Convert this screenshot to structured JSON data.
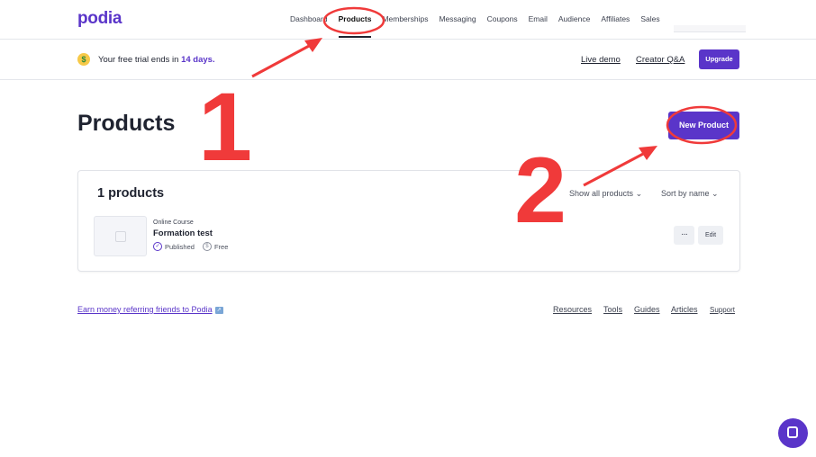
{
  "brand": {
    "logo": "podia",
    "accent": "#5a35c9"
  },
  "nav": {
    "items": [
      {
        "label": "Dashboard",
        "active": false
      },
      {
        "label": "Products",
        "active": true
      },
      {
        "label": "Memberships",
        "active": false
      },
      {
        "label": "Messaging",
        "active": false
      },
      {
        "label": "Coupons",
        "active": false
      },
      {
        "label": "Email",
        "active": false
      },
      {
        "label": "Audience",
        "active": false
      },
      {
        "label": "Affiliates",
        "active": false
      },
      {
        "label": "Sales",
        "active": false
      }
    ]
  },
  "trial_bar": {
    "icon": "money-face-icon",
    "text_prefix": "Your free trial ends in ",
    "days": "14 days.",
    "live_demo": "Live demo",
    "creator_qa": "Creator Q&A",
    "upgrade": "Upgrade"
  },
  "page": {
    "title": "Products",
    "new_product": "New Product"
  },
  "products_card": {
    "count_label": "1 products",
    "filter_label": "Show all products",
    "sort_label": "Sort by name",
    "items": [
      {
        "type": "Online Course",
        "name": "Formation test",
        "status": "Published",
        "price": "Free",
        "more": "···",
        "edit": "Edit"
      }
    ]
  },
  "footer": {
    "refer": "Earn money referring friends to Podia",
    "links": [
      "Resources",
      "Tools",
      "Guides",
      "Articles",
      "Support"
    ]
  },
  "annotations": {
    "number_1": "1",
    "number_2": "2",
    "color": "#f03a3a"
  }
}
